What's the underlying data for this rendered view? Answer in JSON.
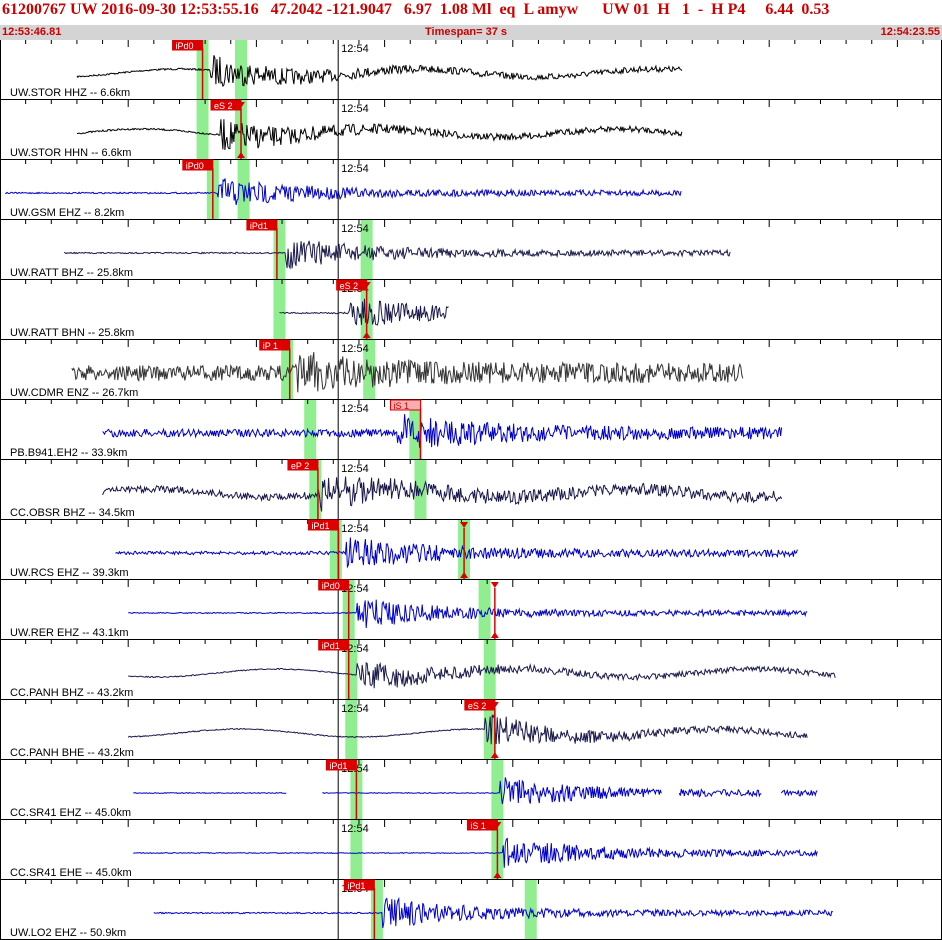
{
  "header": {
    "event_id": "61200767",
    "network": "UW",
    "origin": "2016-09-30 12:53:55.16",
    "lat": "47.2042",
    "lon": "-121.9047",
    "depth": "6.97",
    "magnitude": "1.08 Ml",
    "etype": "eq",
    "gtype": "L",
    "analyst": "amyw",
    "solution": "UW 01  H   1  -  H P4",
    "v1": "6.44",
    "v2": "0.53"
  },
  "timebar": {
    "start": "12:53:46.81",
    "timespan_label": "Timespan=",
    "timespan": "37 s",
    "end": "12:54:23.55"
  },
  "tick_label": "12:54",
  "colors": {
    "header_text": "#cc0000",
    "blue_trace": "#0000cc",
    "navy_trace": "#1a1a4d",
    "black_trace": "#000000",
    "pick": "#dd0000",
    "window": "#90ee90"
  },
  "channels": [
    {
      "label": "UW.STOR HHZ -- 6.6km",
      "color": "black",
      "start": 3,
      "end": 26.6,
      "noise": 0.06,
      "onset": 8.2,
      "lpwave": true,
      "picks": [
        {
          "t": 7.9,
          "label": "iPd0",
          "type": "P"
        }
      ],
      "windows": [
        7.9,
        9.4
      ]
    },
    {
      "label": "UW.STOR HHN -- 6.6km",
      "color": "black",
      "start": 3,
      "end": 26.6,
      "noise": 0.06,
      "onset": 8.6,
      "lpwave": true,
      "picks": [
        {
          "t": 9.4,
          "label": "eS 2",
          "type": "S",
          "tri": true
        }
      ],
      "windows": [
        7.9,
        9.4
      ]
    },
    {
      "label": "UW.GSM EHZ -- 8.2km",
      "color": "blue",
      "start": 0.2,
      "end": 26.6,
      "noise": 0.05,
      "onset": 8.5,
      "picks": [
        {
          "t": 8.3,
          "label": "iPd0",
          "type": "P"
        }
      ],
      "windows": [
        8.3,
        9.5
      ]
    },
    {
      "label": "UW.RATT BHZ -- 25.8km",
      "color": "navy",
      "start": 2.5,
      "end": 28.5,
      "noise": 0.05,
      "onset": 11.1,
      "picks": [
        {
          "t": 10.8,
          "label": "iPd1",
          "type": "P"
        }
      ],
      "windows": [
        10.9,
        14.3
      ]
    },
    {
      "label": "UW.RATT BHN -- 25.8km",
      "color": "navy",
      "start": 10.9,
      "end": 17.5,
      "noise": 0.05,
      "onset": 13.6,
      "picks": [
        {
          "t": 14.3,
          "label": "eS 2",
          "type": "S",
          "tri": true
        }
      ],
      "windows": [
        10.9,
        14.3
      ]
    },
    {
      "label": "UW.CDMR ENZ -- 26.7km",
      "color": "dark",
      "start": 2.8,
      "end": 29,
      "noise": 0.55,
      "onset": 11.5,
      "picks": [
        {
          "t": 11.3,
          "label": "iP 1",
          "type": "P"
        }
      ],
      "windows": [
        11.2,
        14.4
      ]
    },
    {
      "label": "PB.B941.EH2 -- 33.9km",
      "color": "blue",
      "start": 4,
      "end": 30.5,
      "noise": 0.28,
      "onset": 15.5,
      "picks": [
        {
          "t": 16.4,
          "label": "iS 1",
          "type": "S",
          "light": true
        }
      ],
      "windows": [
        12.1,
        16.2
      ]
    },
    {
      "label": "CC.OBSR BHZ -- 34.5km",
      "color": "navy",
      "start": 4,
      "end": 30.5,
      "noise": 0.25,
      "onset": 12.5,
      "lpwave": true,
      "picks": [
        {
          "t": 12.4,
          "label": "eP 2",
          "type": "P"
        }
      ],
      "windows": [
        12.3,
        16.4
      ]
    },
    {
      "label": "UW.RCS EHZ -- 39.3km",
      "color": "blue",
      "start": 4.5,
      "end": 31.1,
      "noise": 0.12,
      "onset": 13.5,
      "picks": [
        {
          "t": 13.2,
          "label": "iPd1",
          "type": "P"
        },
        {
          "t": 18.1,
          "label": "",
          "type": "S",
          "tri": true
        }
      ],
      "windows": [
        13.1,
        18.1
      ]
    },
    {
      "label": "UW.RER EHZ -- 43.1km",
      "color": "blue",
      "start": 5,
      "end": 31.5,
      "noise": 0.04,
      "onset": 13.9,
      "picks": [
        {
          "t": 13.6,
          "label": "iPd0",
          "type": "P"
        },
        {
          "t": 19.3,
          "label": "",
          "type": "S",
          "tri": true
        }
      ],
      "windows": [
        13.6,
        18.9
      ]
    },
    {
      "label": "CC.PANH BHZ -- 43.2km",
      "color": "navy",
      "start": 5,
      "end": 32.6,
      "noise": 0.04,
      "onset": 13.9,
      "lpwave": true,
      "picks": [
        {
          "t": 13.6,
          "label": "iPd1",
          "type": "P"
        }
      ],
      "windows": [
        13.7,
        19.1
      ]
    },
    {
      "label": "CC.PANH BHE -- 43.2km",
      "color": "navy",
      "start": 5,
      "end": 31.5,
      "noise": 0.04,
      "onset": 18.9,
      "lpwave": true,
      "picks": [
        {
          "t": 19.3,
          "label": "eS 2",
          "type": "S",
          "tri": true
        }
      ],
      "windows": [
        13.7,
        19.1
      ]
    },
    {
      "label": "CC.SR41 EHZ -- 45.0km",
      "color": "blue",
      "start": 5.2,
      "end": 31.9,
      "noise": 0.03,
      "onset": 19.5,
      "gaps": true,
      "picks": [
        {
          "t": 13.9,
          "label": "iPd1",
          "type": "P"
        }
      ],
      "windows": [
        13.9,
        19.4
      ]
    },
    {
      "label": "CC.SR41 EHE -- 45.0km",
      "color": "blue",
      "start": 5.2,
      "end": 31.9,
      "noise": 0.03,
      "onset": 19.6,
      "picks": [
        {
          "t": 19.4,
          "label": "iS 1",
          "type": "S",
          "tri": true
        }
      ],
      "windows": [
        13.9,
        19.4
      ]
    },
    {
      "label": "UW.LO2 EHZ -- 50.9km",
      "color": "blue",
      "start": 6,
      "end": 32.5,
      "noise": 0.05,
      "onset": 14.9,
      "picks": [
        {
          "t": 14.6,
          "label": "iPd1",
          "type": "P"
        }
      ],
      "windows": [
        14.7,
        20.7
      ]
    }
  ]
}
